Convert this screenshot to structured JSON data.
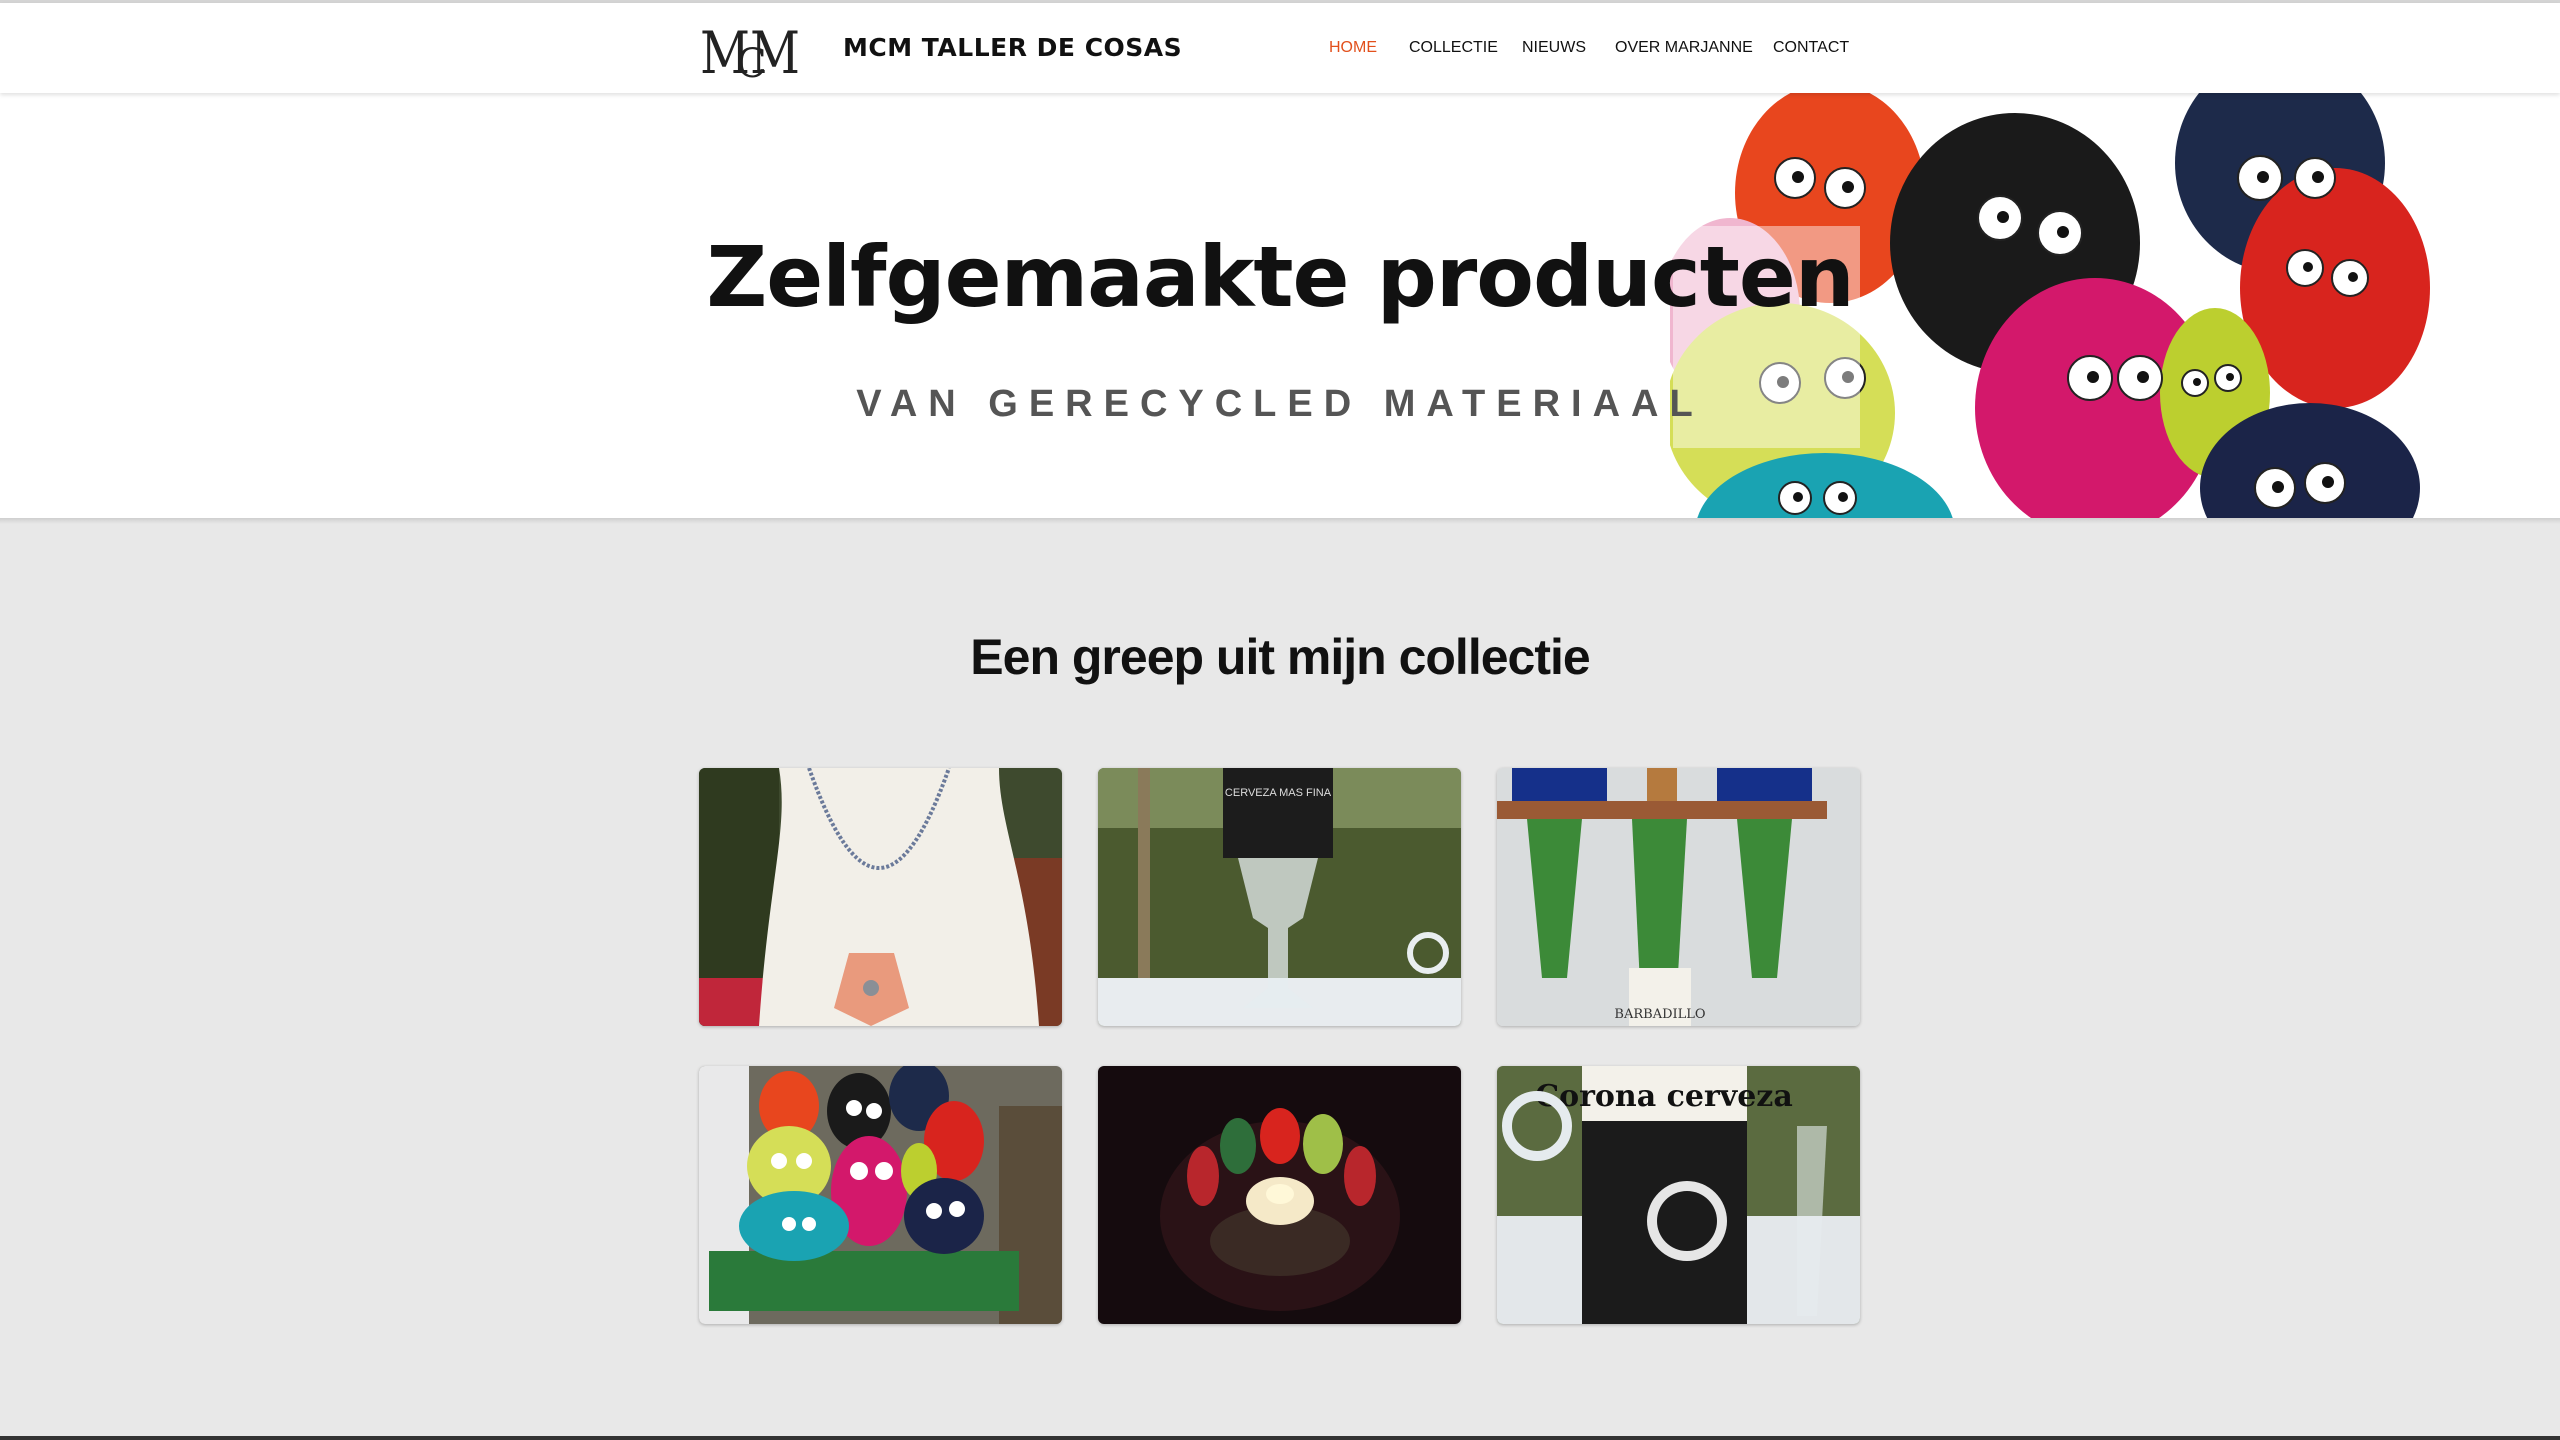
{
  "brand": {
    "logo_text": "MCM",
    "name": "MCM TALLER DE COSAS"
  },
  "nav": {
    "items": [
      "HOME",
      "COLLECTIE",
      "NIEUWS",
      "OVER MARJANNE",
      "CONTACT"
    ],
    "active": "HOME",
    "active_color": "#e2501c"
  },
  "hero": {
    "title": "Zelfgemaakte producten",
    "subtitle": "VAN GERECYCLED MATERIAAL"
  },
  "collection": {
    "title": "Een greep uit mijn collectie",
    "items": [
      {
        "subject": "necklace-with-shell"
      },
      {
        "subject": "glass-from-cerveza-bottle",
        "label_text": "CERVEZA MAS FINA"
      },
      {
        "subject": "green-bottle-vases",
        "label_text": "BARBADILLO"
      },
      {
        "subject": "painted-stone-figures"
      },
      {
        "subject": "candle-holder-with-stones"
      },
      {
        "subject": "corona-bottle-mug",
        "label_text": "Corona cerveza"
      }
    ]
  }
}
